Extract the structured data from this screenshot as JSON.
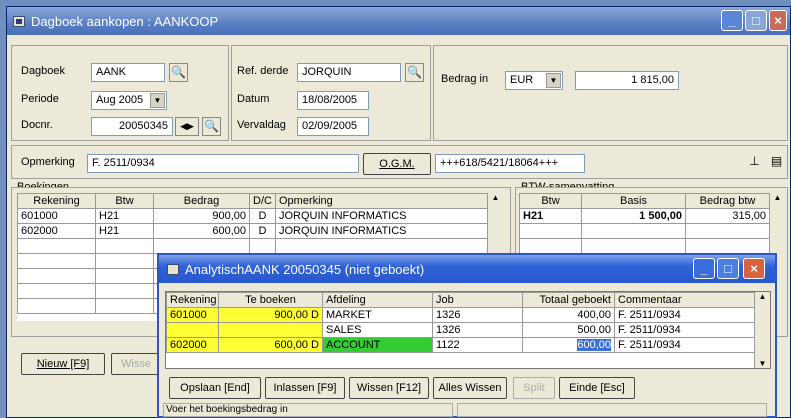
{
  "main": {
    "title": "Dagboek aankopen : AANKOOP",
    "dagboek_label": "Dagboek",
    "dagboek_value": "AANK",
    "periode_label": "Periode",
    "periode_value": "Aug 2005",
    "docnr_label": "Docnr.",
    "docnr_value": "20050345",
    "refderde_label": "Ref. derde",
    "refderde_value": "JORQUIN",
    "datum_label": "Datum",
    "datum_value": "18/08/2005",
    "vervaldag_label": "Vervaldag",
    "vervaldag_value": "02/09/2005",
    "bedrag_label": "Bedrag in",
    "currency_value": "EUR",
    "bedrag_value": "1 815,00",
    "opmerking_label": "Opmerking",
    "opmerking_value": "F. 2511/0934",
    "ogm_button": "O.G.M.",
    "ogm_value": "+++618/5421/18064+++",
    "new_button": "Nieuw [F9]",
    "wissen_button_partial": "Wisse"
  },
  "boekingen": {
    "title": "Boekingen",
    "columns": [
      "Rekening",
      "Btw",
      "Bedrag",
      "D/C",
      "Opmerking"
    ],
    "rows": [
      [
        "601000",
        "H21",
        "900,00",
        "D",
        "JORQUIN INFORMATICS"
      ],
      [
        "602000",
        "H21",
        "600,00",
        "D",
        "JORQUIN INFORMATICS"
      ]
    ]
  },
  "btw": {
    "title": "BTW-samenvatting",
    "columns": [
      "Btw",
      "Basis",
      "Bedrag btw"
    ],
    "rows": [
      [
        "H21",
        "1 500,00",
        "315,00"
      ]
    ]
  },
  "dialog": {
    "title": "AnalytischAANK 20050345 (niet geboekt)",
    "columns": [
      "Rekening",
      "Te boeken",
      "Afdeling",
      "Job",
      "Totaal geboekt",
      "Commentaar"
    ],
    "rows": [
      [
        "601000",
        "900,00 D",
        "MARKET",
        "1326",
        "400,00",
        "F. 2511/0934"
      ],
      [
        "",
        "",
        "SALES",
        "1326",
        "500,00",
        "F. 2511/0934"
      ],
      [
        "602000",
        "600,00 D",
        "ACCOUNT",
        "1122",
        "600,00",
        "F. 2511/0934"
      ]
    ],
    "buttons": {
      "opslaan": "Opslaan [End]",
      "inlassen": "Inlassen [F9]",
      "wissen": "Wissen [F12]",
      "alles_wissen": "Alles Wissen",
      "split": "Split",
      "einde": "Einde [Esc]"
    },
    "status": "Voer het boekingsbedrag in"
  },
  "colors": {
    "highlight_yellow": "#ffff33",
    "highlight_green": "#33cc33",
    "selection_blue": "#3a6fd6"
  }
}
